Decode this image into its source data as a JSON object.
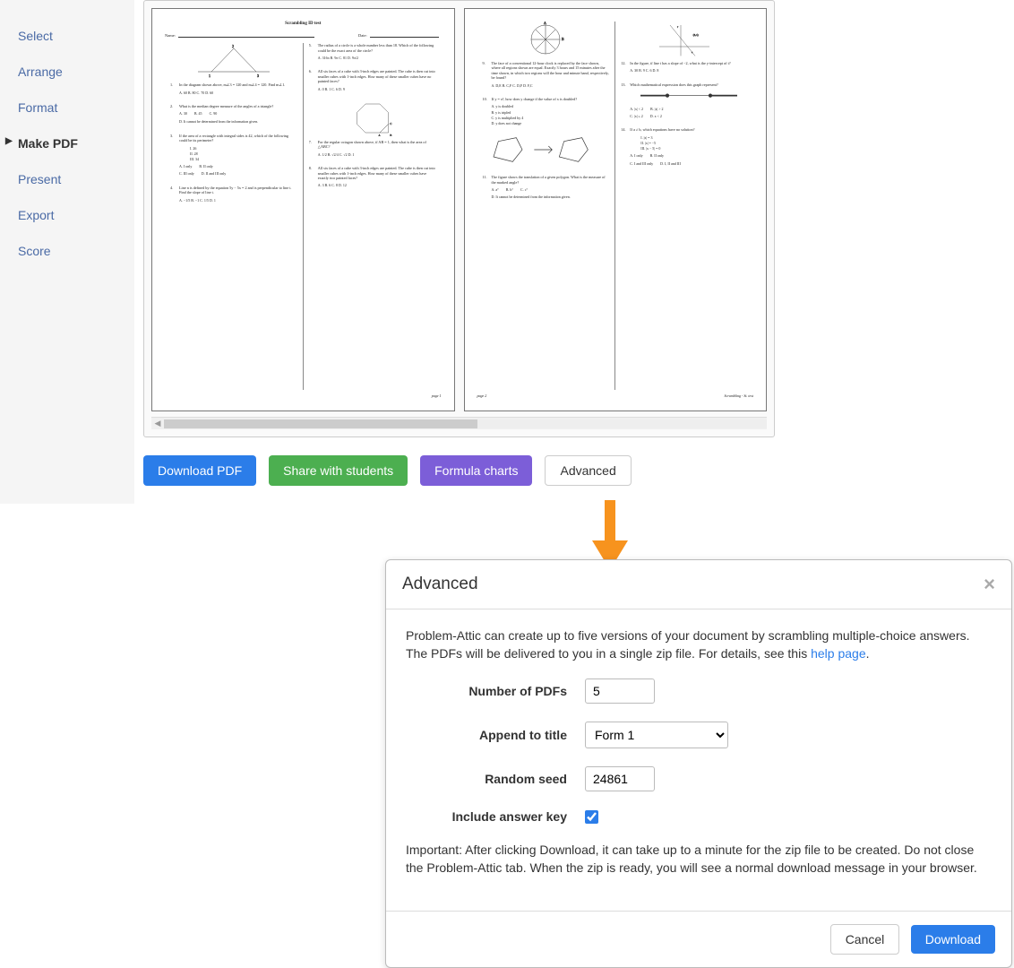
{
  "sidebar": {
    "items": [
      {
        "label": "Select"
      },
      {
        "label": "Arrange"
      },
      {
        "label": "Format"
      },
      {
        "label": "Make PDF"
      },
      {
        "label": "Present"
      },
      {
        "label": "Export"
      },
      {
        "label": "Score"
      }
    ]
  },
  "preview": {
    "page1": {
      "title": "Scrambling ID test",
      "name_label": "Name:",
      "date_label": "Date:",
      "page_num": "page 1",
      "q1": {
        "text": "In the diagram shown above, m∠3 = 120 and m∠4 = 120. Find m∠1.",
        "choices": "A. 60    B. 80    C. 70    D. 60"
      },
      "q2": {
        "text": "What is the median degree measure of the angles of a triangle?",
        "a": "A. 30",
        "b": "B. 45",
        "c": "C. 90",
        "d": "D. It cannot be determined from the information given."
      },
      "q3": {
        "text": "If the area of a rectangle with integral sides is 42, which of the following could be its perimeter?",
        "i": "I. 26",
        "ii": "II. 28",
        "iii": "III. 34",
        "a": "A. I only",
        "b": "B. II only",
        "c": "C. III only",
        "d": "D. II and III only"
      },
      "q4": {
        "text": "Line n is defined by the equation 5y − 5x = 2 and is perpendicular to line t. Find the slope of line t.",
        "choices": "A. −1/5    B. −1    C. 1/5    D. 1"
      },
      "q5": {
        "text": "The radius of a circle is a whole number less than 18. Which of the following could be the exact area of the circle?",
        "choices": "A. 316π    B. 9π    C. 81    D. 9π/2"
      },
      "q6": {
        "text": "All six faces of a cube with 3-inch edges are painted. The cube is then cut into smaller cubes with 1-inch edges. How many of these smaller cubes have no painted faces?",
        "choices": "A. 0    B. 1    C. 6    D. 9"
      },
      "q7": {
        "text": "For the regular octagon shown above, if AB = 1, then what is the area of △ABC?",
        "choices": "A. 1/2    B. √2/4    C. √2    D. 1"
      },
      "q8": {
        "text": "All six faces of a cube with 3-inch edges are painted. The cube is then cut into smaller cubes with 1-inch edges. How many of these smaller cubes have exactly two painted faces?",
        "choices": "A. 3    B. 6    C. 8    D. 12"
      }
    },
    "page2": {
      "page_num": "page 2",
      "footer_right": "Scrambling - St. test",
      "q9": {
        "text": "The face of a conventional 12-hour clock is replaced by the face shown, where all regions shown are equal. Exactly 3 hours and 15 minutes after the time shown, in which two regions will the hour and minute hand, respectively, be found?",
        "choices": "A. D,E    B. C,F    C. D,F    D. F,C"
      },
      "q10": {
        "text": "If y = x², how does y change if the value of x is doubled?",
        "a": "A. y is doubled",
        "b": "B. y is tripled",
        "c": "C. y is multiplied by 4",
        "d": "D. y does not change"
      },
      "q11": {
        "text": "The figure shows the translation of a given polygon. What is the measure of the marked angle?",
        "a": "A. a°",
        "b": "B. b°",
        "c": "C. c°",
        "d": "D. It cannot be determined from the information given."
      },
      "q12": {
        "text": "In the figure, if line t has a slope of −2, what is the y-intercept of t?",
        "choices": "A. 30    B. 9    C. 6    D. 8"
      },
      "q13": {
        "text": "Which mathematical expression does this graph represent?",
        "a": "A. |x| < 2",
        "b": "B. |x| > 2",
        "c": "C. |x| ≤ 2",
        "d": "D. x < 2"
      },
      "q14": {
        "text": "If a ≠ b, which equations have no solution?",
        "i": "I. |x| = 3",
        "ii": "II. |x| = −5",
        "iii": "III. |x − 5| = 0",
        "a": "A. I only",
        "b": "B. II only",
        "c": "C. I and III only",
        "d": "D. I, II and III"
      }
    }
  },
  "buttons": {
    "download_pdf": "Download PDF",
    "share": "Share with students",
    "formula": "Formula charts",
    "advanced": "Advanced"
  },
  "modal": {
    "title": "Advanced",
    "intro_before_link": "Problem-Attic can create up to five versions of your document by scrambling multiple-choice answers. The PDFs will be delivered to you in a single zip file. For details, see this ",
    "link_text": "help page",
    "intro_after_link": ".",
    "num_pdfs_label": "Number of PDFs",
    "num_pdfs_value": "5",
    "append_label": "Append to title",
    "append_value": "Form 1",
    "seed_label": "Random seed",
    "seed_value": "24861",
    "answerkey_label": "Include answer key",
    "important": "Important: After clicking Download, it can take up to a minute for the zip file to be created. Do not close the Problem-Attic tab. When the zip is ready, you will see a normal download message in your browser.",
    "cancel": "Cancel",
    "download": "Download"
  }
}
